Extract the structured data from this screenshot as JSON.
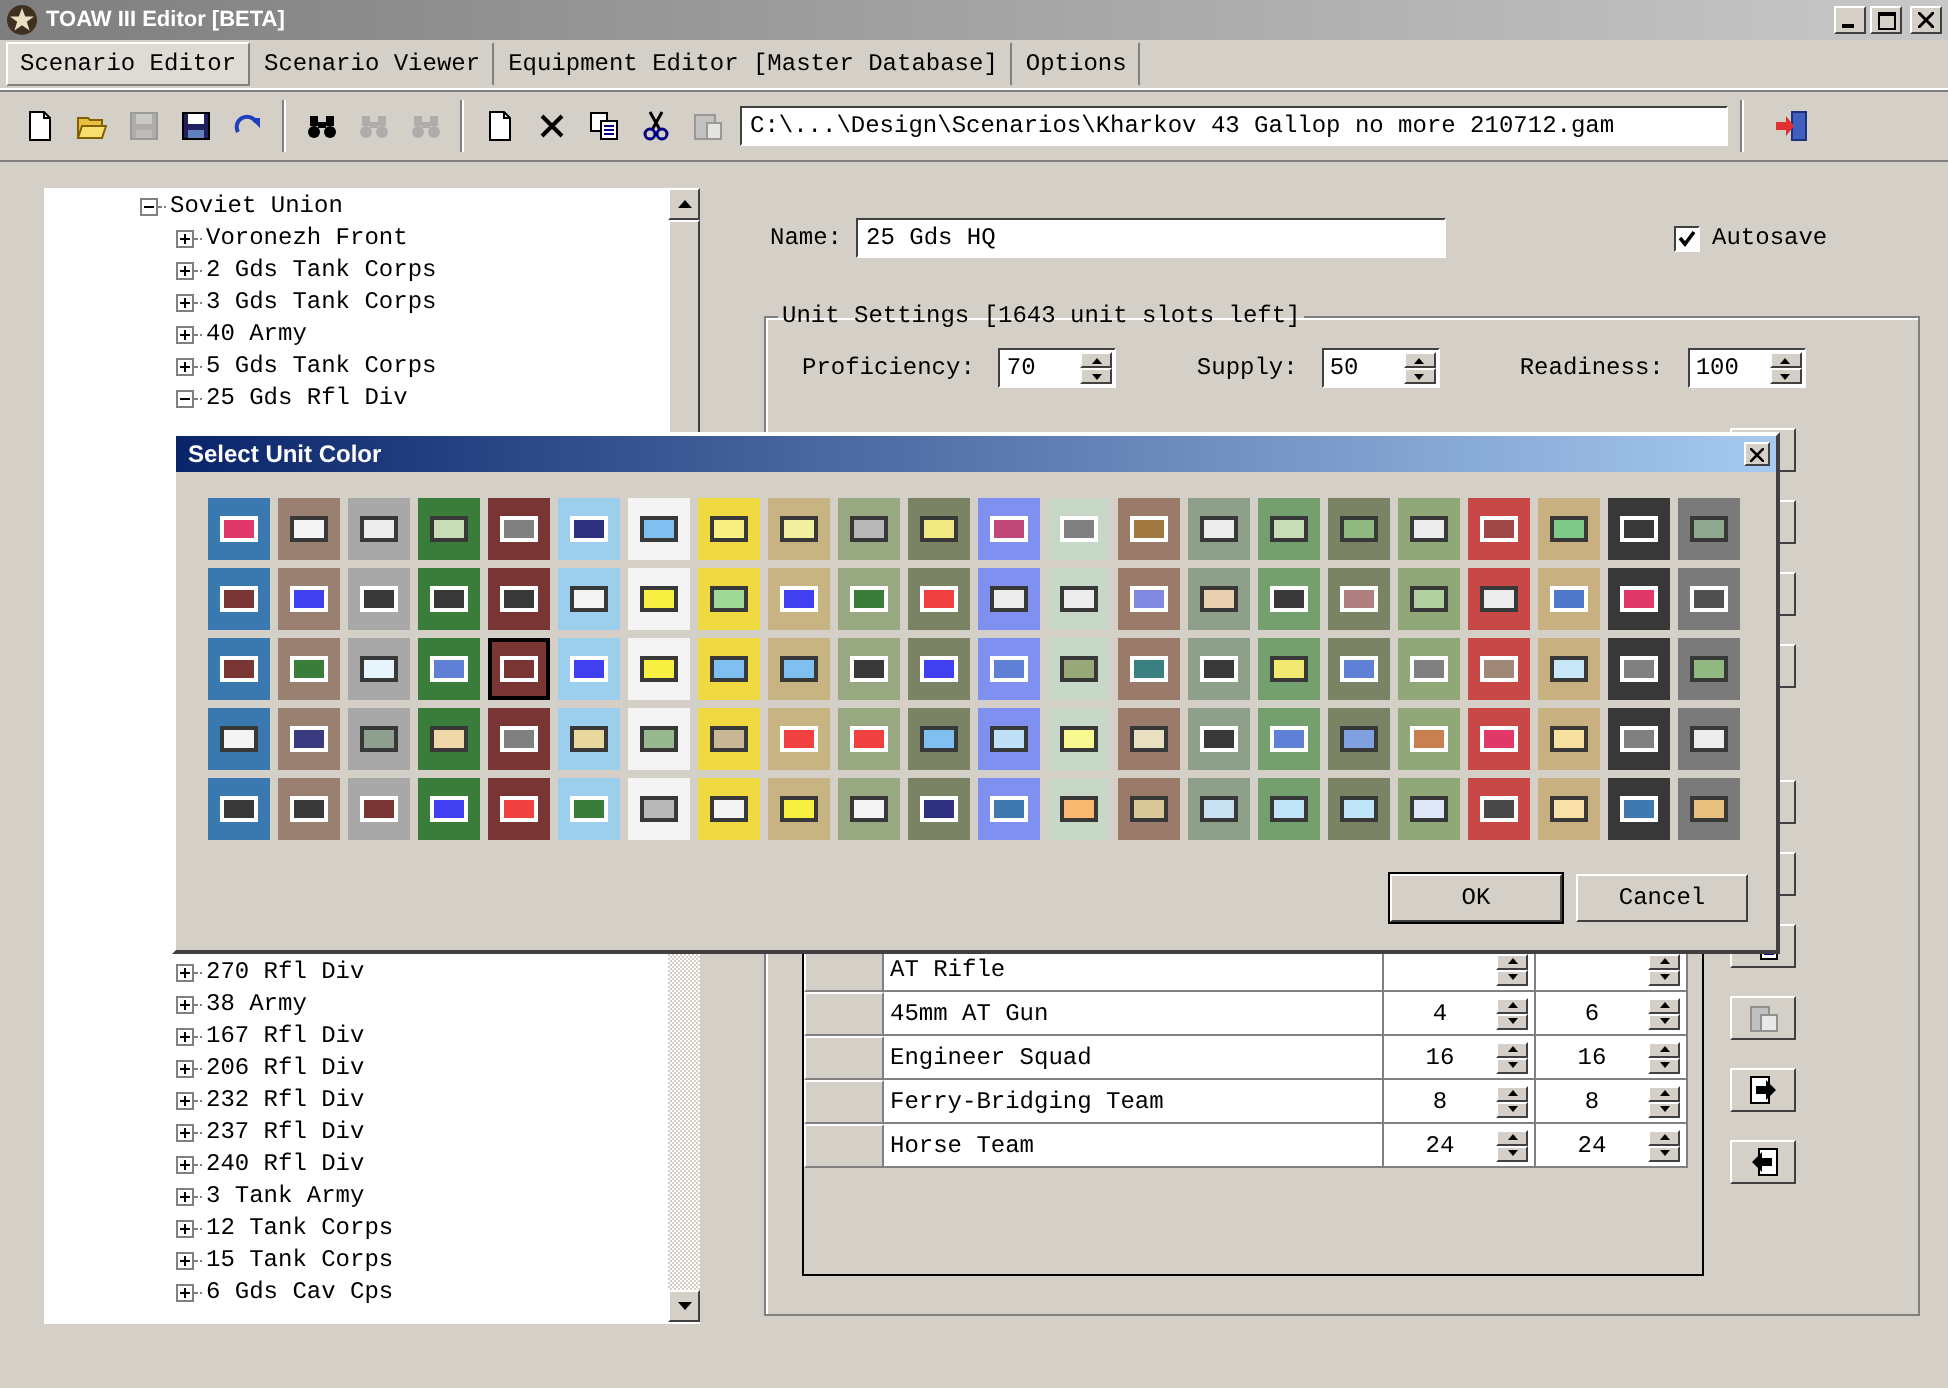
{
  "window": {
    "title": "TOAW III Editor [BETA]"
  },
  "menu_tabs": [
    {
      "label": "Scenario Editor",
      "selected": true
    },
    {
      "label": "Scenario Viewer",
      "selected": false
    },
    {
      "label": "Equipment Editor [Master Database]",
      "selected": false
    },
    {
      "label": "Options",
      "selected": false
    }
  ],
  "toolbar": {
    "buttons": [
      {
        "kind": "new",
        "disabled": false
      },
      {
        "kind": "open",
        "disabled": false
      },
      {
        "kind": "save",
        "disabled": true
      },
      {
        "kind": "save-as",
        "disabled": false
      },
      {
        "kind": "redo",
        "disabled": false
      },
      {
        "kind": "find",
        "disabled": false
      },
      {
        "kind": "find",
        "disabled": true
      },
      {
        "kind": "find",
        "disabled": true
      },
      {
        "kind": "new",
        "disabled": false
      },
      {
        "kind": "delete",
        "disabled": false
      },
      {
        "kind": "copy",
        "disabled": false
      },
      {
        "kind": "cut",
        "disabled": false
      },
      {
        "kind": "paste",
        "disabled": true
      }
    ],
    "path": "C:\\...\\Design\\Scenarios\\Kharkov 43 Gallop no more 210712.gam"
  },
  "tree": {
    "items": [
      {
        "label": "Soviet Union",
        "expanded": true,
        "children": [
          {
            "label": "Voronezh Front",
            "expanded": false
          },
          {
            "label": "2 Gds Tank Corps",
            "expanded": false
          },
          {
            "label": "3 Gds Tank Corps",
            "expanded": false
          },
          {
            "label": "40 Army",
            "expanded": false
          },
          {
            "label": "5 Gds Tank Corps",
            "expanded": false
          },
          {
            "label": "25 Gds Rfl Div",
            "expanded": true
          }
        ]
      }
    ],
    "lower_items": [
      {
        "label": "270 Rfl Div",
        "expanded": false
      },
      {
        "label": "38 Army",
        "expanded": false
      },
      {
        "label": "167 Rfl Div",
        "expanded": false
      },
      {
        "label": "206 Rfl Div",
        "expanded": false
      },
      {
        "label": "232 Rfl Div",
        "expanded": false
      },
      {
        "label": "237 Rfl Div",
        "expanded": false
      },
      {
        "label": "240 Rfl Div",
        "expanded": false
      },
      {
        "label": "3 Tank Army",
        "expanded": false
      },
      {
        "label": "12 Tank Corps",
        "expanded": false
      },
      {
        "label": "15 Tank Corps",
        "expanded": false
      },
      {
        "label": "6 Gds Cav Cps",
        "expanded": false
      }
    ]
  },
  "name_field": {
    "label": "Name:",
    "value": "25 Gds HQ"
  },
  "autosave": {
    "label": "Autosave",
    "checked": true
  },
  "unit_settings": {
    "title": "Unit Settings [1643 unit slots left]",
    "fields": [
      {
        "label": "Proficiency:",
        "value": "70"
      },
      {
        "label": "Supply:",
        "value": "50"
      },
      {
        "label": "Readiness:",
        "value": "100"
      }
    ],
    "equipment_rows": [
      {
        "name": "AT Rifle"
      },
      {
        "name": "45mm AT Gun",
        "count_1": "4",
        "count_2": "6"
      },
      {
        "name": "Engineer Squad",
        "count_1": "16",
        "count_2": "16"
      },
      {
        "name": "Ferry-Bridging Team",
        "count_1": "8",
        "count_2": "8"
      },
      {
        "name": "Horse Team",
        "count_1": "24",
        "count_2": "24"
      }
    ]
  },
  "color_dialog": {
    "title": "Select Unit Color",
    "buttons": [
      "OK",
      "Cancel"
    ],
    "columns": [
      {
        "color": "#3a78b0",
        "swatches": [
          {
            "color": "#e0386a",
            "selected": false
          },
          {
            "color": "#7a3535",
            "selected": false
          },
          {
            "color": "#7a3535",
            "selected": false
          },
          {
            "color": "#f4f4f4",
            "selected": false
          },
          {
            "color": "#383838",
            "selected": false
          }
        ]
      },
      {
        "color": "#9a8070",
        "swatches": [
          {
            "color": "#f4f4f4",
            "selected": false
          },
          {
            "color": "#4040f0",
            "selected": false
          },
          {
            "color": "#3a7d3a",
            "selected": false
          },
          {
            "color": "#3a3a80",
            "selected": false
          },
          {
            "color": "#383838",
            "selected": false
          }
        ]
      },
      {
        "color": "#a8a8a8",
        "swatches": [
          {
            "color": "#ececec",
            "selected": false
          },
          {
            "color": "#383838",
            "selected": false
          },
          {
            "color": "#e8f4fc",
            "selected": false
          },
          {
            "color": "#90a090",
            "selected": false
          },
          {
            "color": "#7a3535",
            "selected": false
          }
        ]
      },
      {
        "color": "#3a7d3a",
        "swatches": [
          {
            "color": "#c8dcb8",
            "selected": false
          },
          {
            "color": "#383838",
            "selected": false
          },
          {
            "color": "#6080d8",
            "selected": false
          },
          {
            "color": "#f0d8a8",
            "selected": false
          },
          {
            "color": "#4040f0",
            "selected": false
          }
        ]
      },
      {
        "color": "#7a3535",
        "swatches": [
          {
            "color": "#808080",
            "selected": false
          },
          {
            "color": "#383838",
            "selected": false
          },
          {
            "color": "#7a3535",
            "selected": true
          },
          {
            "color": "#808080",
            "selected": false
          },
          {
            "color": "#f04040",
            "selected": false
          }
        ]
      },
      {
        "color": "#9ccfee",
        "swatches": [
          {
            "color": "#303080",
            "selected": false
          },
          {
            "color": "#f4f4f4",
            "selected": false
          },
          {
            "color": "#4040f0",
            "selected": false
          },
          {
            "color": "#e8d8a0",
            "selected": false
          },
          {
            "color": "#3a7d3a",
            "selected": false
          }
        ]
      },
      {
        "color": "#f4f4f4",
        "swatches": [
          {
            "color": "#80c0f0",
            "selected": false
          },
          {
            "color": "#f8f040",
            "selected": false
          },
          {
            "color": "#f8f040",
            "selected": false
          },
          {
            "color": "#98b890",
            "selected": false
          },
          {
            "color": "#b8b8b8",
            "selected": false
          }
        ]
      },
      {
        "color": "#f0d840",
        "swatches": [
          {
            "color": "#f8f080",
            "selected": false
          },
          {
            "color": "#a0d898",
            "selected": false
          },
          {
            "color": "#80c0f0",
            "selected": false
          },
          {
            "color": "#c8b898",
            "selected": false
          },
          {
            "color": "#f4f4f4",
            "selected": false
          }
        ]
      },
      {
        "color": "#c8b482",
        "swatches": [
          {
            "color": "#f0f0a0",
            "selected": false
          },
          {
            "color": "#4040f0",
            "selected": false
          },
          {
            "color": "#80c0f0",
            "selected": false
          },
          {
            "color": "#f04040",
            "selected": false
          },
          {
            "color": "#f8f040",
            "selected": false
          }
        ]
      },
      {
        "color": "#98a880",
        "swatches": [
          {
            "color": "#b8b8b8",
            "selected": false
          },
          {
            "color": "#3a7d3a",
            "selected": false
          },
          {
            "color": "#383838",
            "selected": false
          },
          {
            "color": "#f04040",
            "selected": false
          },
          {
            "color": "#f4f4f4",
            "selected": false
          }
        ]
      },
      {
        "color": "#7a8464",
        "swatches": [
          {
            "color": "#f0e880",
            "selected": false
          },
          {
            "color": "#f04040",
            "selected": false
          },
          {
            "color": "#4040f0",
            "selected": false
          },
          {
            "color": "#80c0f0",
            "selected": false
          },
          {
            "color": "#303080",
            "selected": false
          }
        ]
      },
      {
        "color": "#8090f0",
        "swatches": [
          {
            "color": "#c04878",
            "selected": false
          },
          {
            "color": "#ececec",
            "selected": false
          },
          {
            "color": "#6080d8",
            "selected": false
          },
          {
            "color": "#c0e0f8",
            "selected": false
          },
          {
            "color": "#4078b0",
            "selected": false
          }
        ]
      },
      {
        "color": "#c8d8c8",
        "swatches": [
          {
            "color": "#808080",
            "selected": false
          },
          {
            "color": "#ececec",
            "selected": false
          },
          {
            "color": "#98a878",
            "selected": false
          },
          {
            "color": "#f8f890",
            "selected": false
          },
          {
            "color": "#f8b870",
            "selected": false
          }
        ]
      },
      {
        "color": "#9a7a68",
        "swatches": [
          {
            "color": "#a07840",
            "selected": false
          },
          {
            "color": "#8088e0",
            "selected": false
          },
          {
            "color": "#3a8080",
            "selected": false
          },
          {
            "color": "#e8e0c0",
            "selected": false
          },
          {
            "color": "#d8c898",
            "selected": false
          }
        ]
      },
      {
        "color": "#8ea08a",
        "swatches": [
          {
            "color": "#ececec",
            "selected": false
          },
          {
            "color": "#e8d0b0",
            "selected": false
          },
          {
            "color": "#383838",
            "selected": false
          },
          {
            "color": "#383838",
            "selected": false
          },
          {
            "color": "#c8e0f0",
            "selected": false
          }
        ]
      },
      {
        "color": "#74a070",
        "swatches": [
          {
            "color": "#c8dcb8",
            "selected": false
          },
          {
            "color": "#383838",
            "selected": false
          },
          {
            "color": "#f0e870",
            "selected": false
          },
          {
            "color": "#6080d8",
            "selected": false
          },
          {
            "color": "#c0e4f8",
            "selected": false
          }
        ]
      },
      {
        "color": "#7a8464",
        "swatches": [
          {
            "color": "#90b880",
            "selected": false
          },
          {
            "color": "#b08080",
            "selected": false
          },
          {
            "color": "#6080d8",
            "selected": false
          },
          {
            "color": "#80a0e0",
            "selected": false
          },
          {
            "color": "#c0e4f8",
            "selected": false
          }
        ]
      },
      {
        "color": "#90a878",
        "swatches": [
          {
            "color": "#ececec",
            "selected": false
          },
          {
            "color": "#b0d0a0",
            "selected": false
          },
          {
            "color": "#808080",
            "selected": false
          },
          {
            "color": "#c88050",
            "selected": false
          },
          {
            "color": "#e0e8f8",
            "selected": false
          }
        ]
      },
      {
        "color": "#c84848",
        "swatches": [
          {
            "color": "#a04848",
            "selected": false
          },
          {
            "color": "#ececec",
            "selected": false
          },
          {
            "color": "#a08878",
            "selected": false
          },
          {
            "color": "#e03868",
            "selected": false
          },
          {
            "color": "#484848",
            "selected": false
          }
        ]
      },
      {
        "color": "#c8b080",
        "swatches": [
          {
            "color": "#80c888",
            "selected": false
          },
          {
            "color": "#5078c8",
            "selected": false
          },
          {
            "color": "#c8e8f8",
            "selected": false
          },
          {
            "color": "#f8e0a0",
            "selected": false
          },
          {
            "color": "#f8e0a8",
            "selected": false
          }
        ]
      },
      {
        "color": "#383838",
        "swatches": [
          {
            "color": "#383838",
            "selected": false
          },
          {
            "color": "#e03868",
            "selected": false
          },
          {
            "color": "#808080",
            "selected": false
          },
          {
            "color": "#808080",
            "selected": false
          },
          {
            "color": "#4078b0",
            "selected": false
          }
        ]
      },
      {
        "color": "#7a7a7a",
        "swatches": [
          {
            "color": "#90a890",
            "selected": false
          },
          {
            "color": "#505050",
            "selected": false
          },
          {
            "color": "#90b880",
            "selected": false
          },
          {
            "color": "#ececec",
            "selected": false
          },
          {
            "color": "#e8c080",
            "selected": false
          }
        ]
      }
    ]
  }
}
